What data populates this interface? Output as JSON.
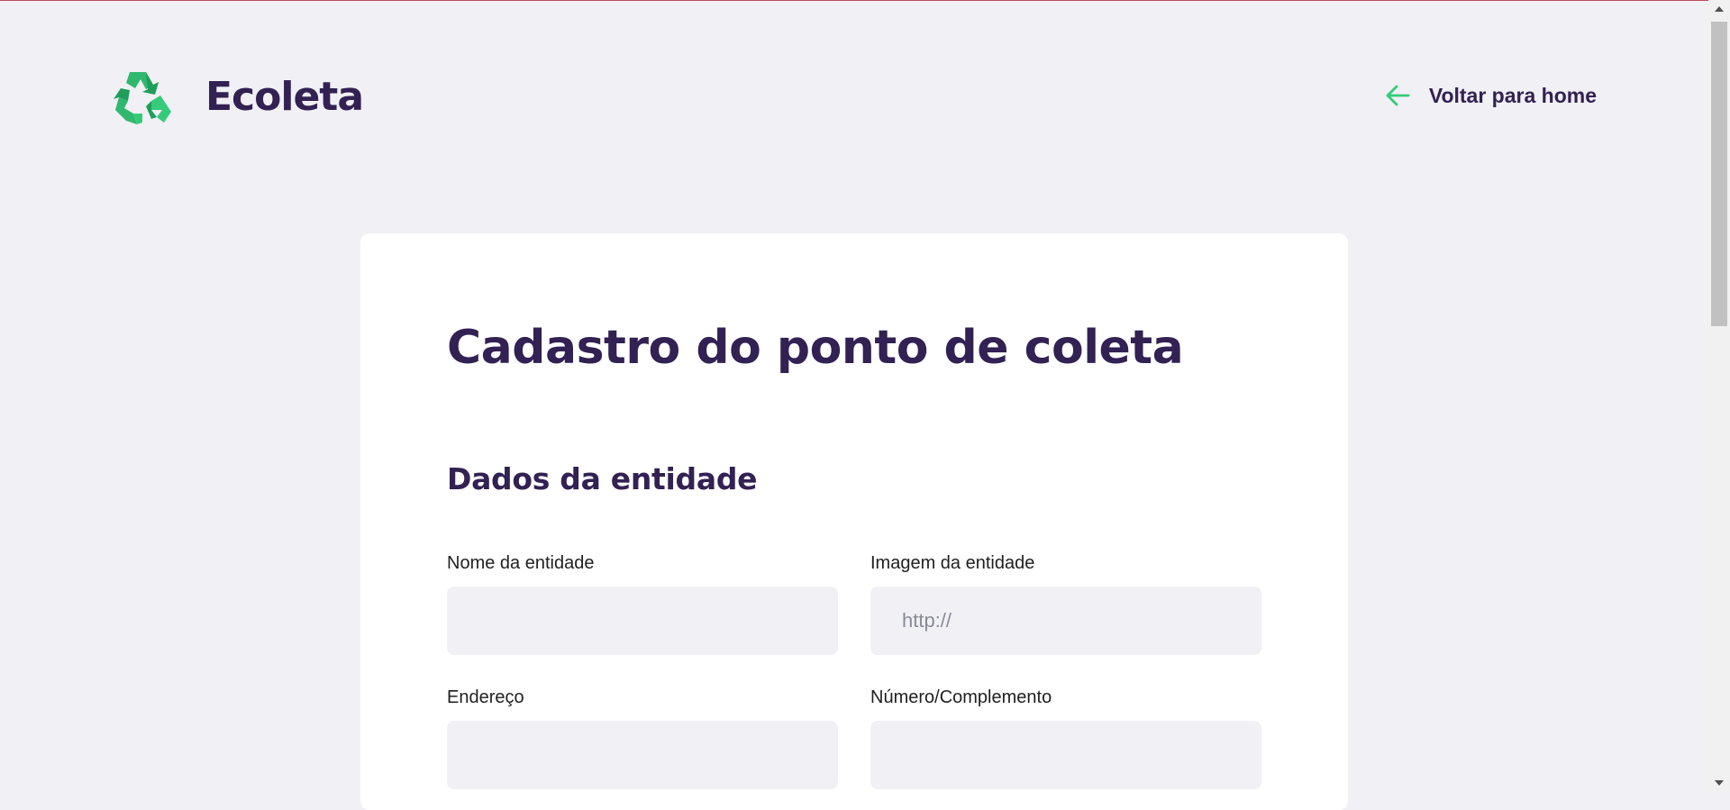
{
  "app": {
    "brand": "Ecoleta",
    "logo_icon": "recycle-icon",
    "colors": {
      "brand_primary": "#322153",
      "accent_green": "#34CB79",
      "background": "#F0F0F5",
      "card": "#FFFFFF"
    }
  },
  "header": {
    "back_label": "Voltar para home",
    "back_icon": "arrow-left-icon"
  },
  "form": {
    "title": "Cadastro do ponto de coleta",
    "section_title": "Dados da entidade",
    "fields": [
      {
        "label": "Nome da entidade",
        "value": "",
        "placeholder": ""
      },
      {
        "label": "Imagem da entidade",
        "value": "",
        "placeholder": "http://"
      },
      {
        "label": "Endereço",
        "value": "",
        "placeholder": ""
      },
      {
        "label": "Número/Complemento",
        "value": "",
        "placeholder": ""
      }
    ]
  }
}
